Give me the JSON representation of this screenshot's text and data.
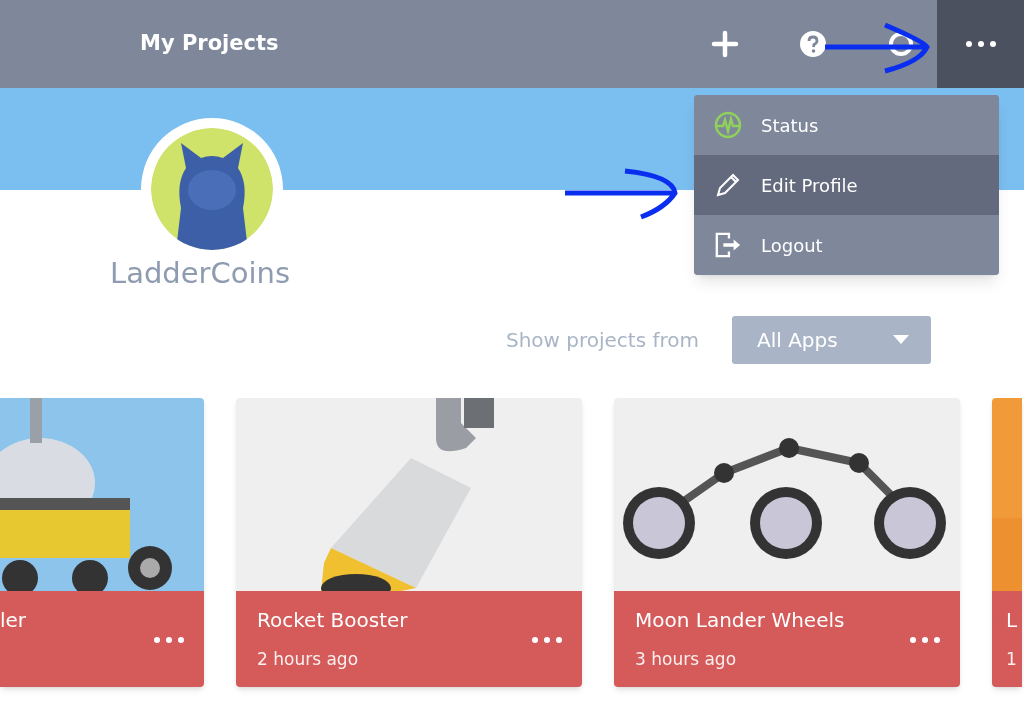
{
  "header": {
    "title": "My Projects",
    "menu_open": true
  },
  "menu": {
    "items": [
      {
        "kind": "status",
        "label": "Status",
        "selected": false
      },
      {
        "kind": "edit",
        "label": "Edit Profile",
        "selected": true
      },
      {
        "kind": "logout",
        "label": "Logout",
        "selected": false
      }
    ]
  },
  "profile": {
    "username": "LadderCoins"
  },
  "filter": {
    "label": "Show projects from",
    "value": "All Apps"
  },
  "projects": [
    {
      "kind": "rover",
      "title": "ler"
    },
    {
      "kind": "booster",
      "title": "Rocket Booster",
      "time": "2 hours ago"
    },
    {
      "kind": "wheels",
      "title": "Moon Lander Wheels",
      "time": "3 hours ago"
    },
    {
      "kind": "orange",
      "title": "L",
      "time": "1"
    }
  ]
}
